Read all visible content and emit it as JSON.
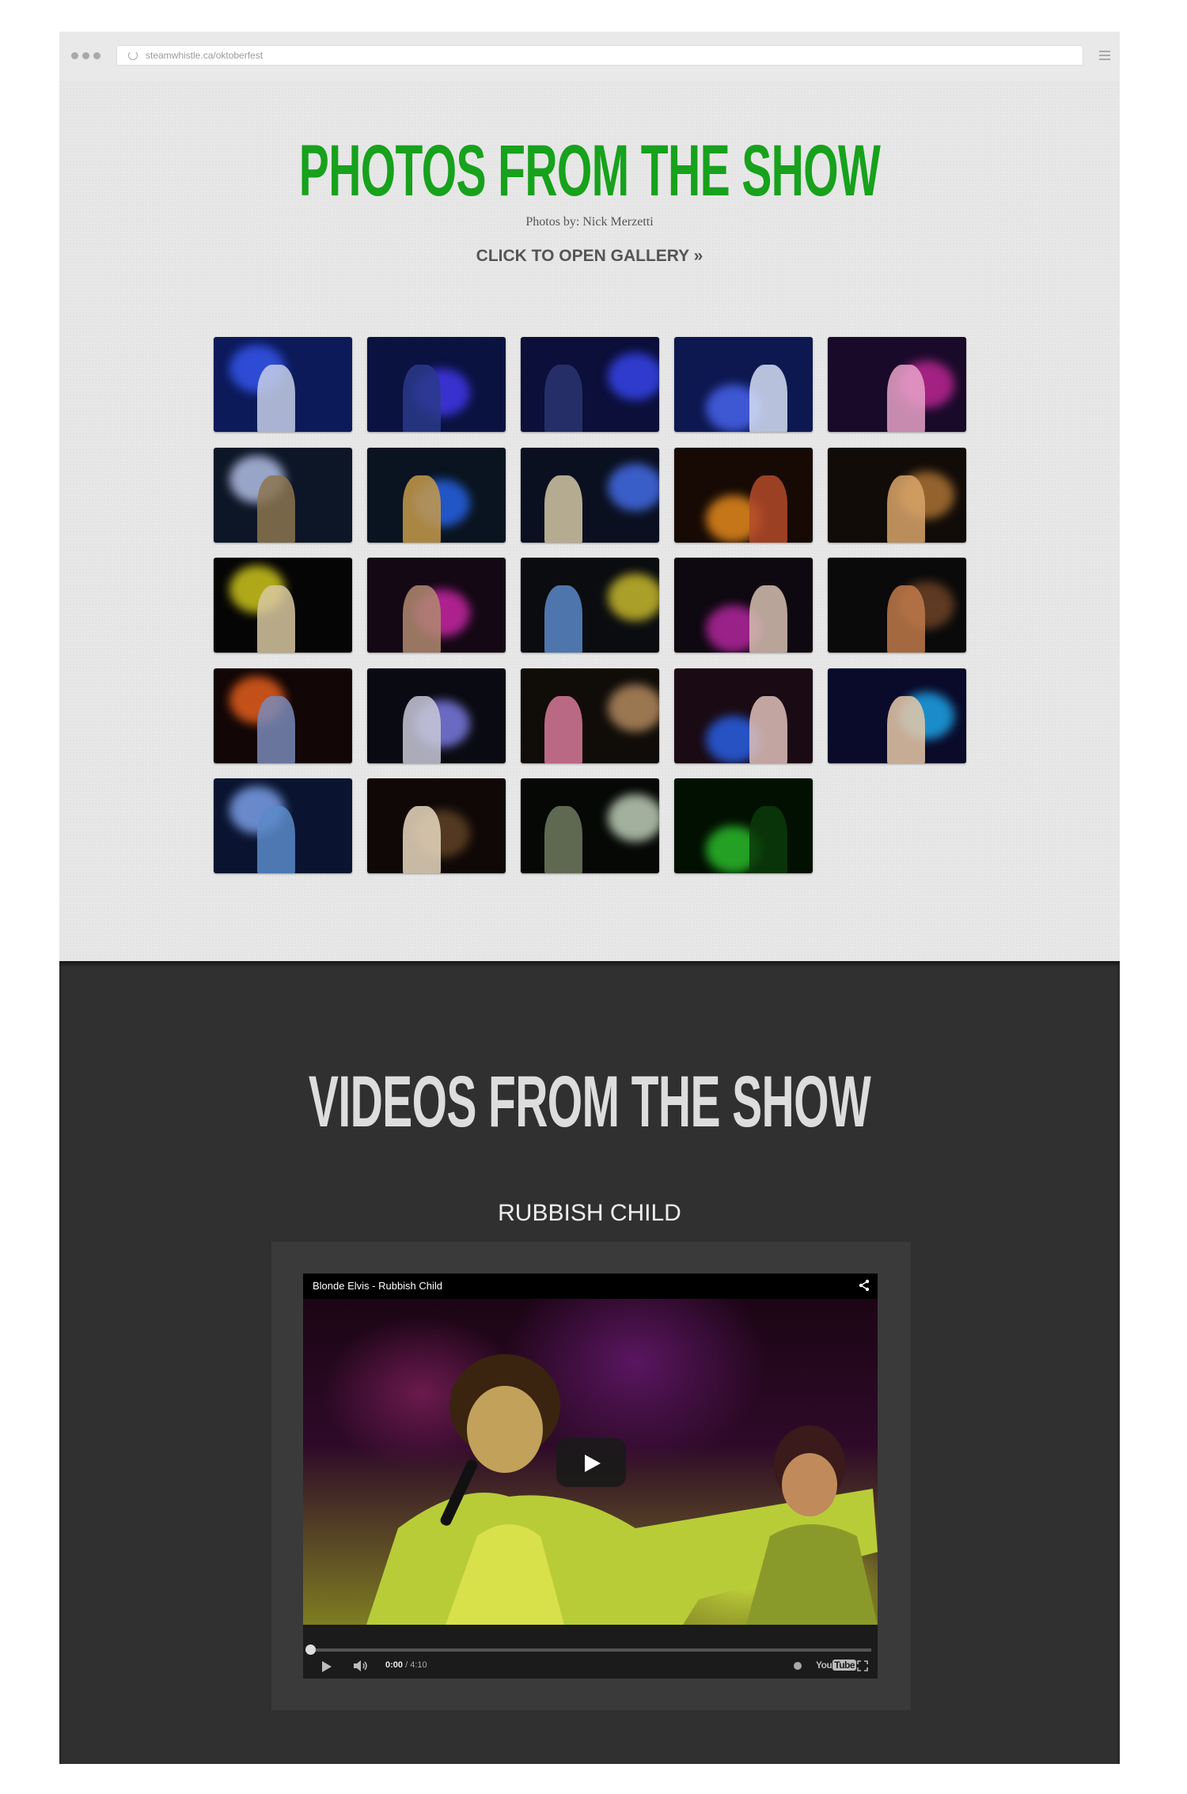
{
  "browser": {
    "url": "steamwhistle.ca/oktoberfest"
  },
  "photos_section": {
    "title": "PHOTOS FROM THE SHOW",
    "credit": "Photos by: Nick Merzetti",
    "gallery_link": "CLICK TO OPEN GALLERY »",
    "thumbnails": [
      {
        "bg": "#0c1a5a",
        "glow": "#3a5cff",
        "fig": "#c7cfe8"
      },
      {
        "bg": "#0a1240",
        "glow": "#4a3cff",
        "fig": "#2a3a8a"
      },
      {
        "bg": "#0b0f3a",
        "glow": "#3b4bff",
        "fig": "#2c3470"
      },
      {
        "bg": "#0d1850",
        "glow": "#4f6cff",
        "fig": "#d6dff5"
      },
      {
        "bg": "#1a0a2a",
        "glow": "#d02aa0",
        "fig": "#e8a2c8"
      },
      {
        "bg": "#0d1626",
        "glow": "#c9d6ff",
        "fig": "#8c7450"
      },
      {
        "bg": "#0a1420",
        "glow": "#2a6cff",
        "fig": "#c79a4a"
      },
      {
        "bg": "#0b1020",
        "glow": "#4a78ff",
        "fig": "#d4c7a6"
      },
      {
        "bg": "#170a05",
        "glow": "#ff9a20",
        "fig": "#b44a2a"
      },
      {
        "bg": "#120c08",
        "glow": "#c0803a",
        "fig": "#d8a46a"
      },
      {
        "bg": "#050505",
        "glow": "#e8e020",
        "fig": "#d8c8a0"
      },
      {
        "bg": "#140814",
        "glow": "#e02ab8",
        "fig": "#b08a70"
      },
      {
        "bg": "#0a0c10",
        "glow": "#e0d030",
        "fig": "#5a8ac8"
      },
      {
        "bg": "#0e0810",
        "glow": "#c82ab0",
        "fig": "#d6c0b0"
      },
      {
        "bg": "#0a0a0a",
        "glow": "#7a4a2a",
        "fig": "#c07a4a"
      },
      {
        "bg": "#120606",
        "glow": "#ff6a20",
        "fig": "#7a8ab8"
      },
      {
        "bg": "#0a0a12",
        "glow": "#8a8aff",
        "fig": "#c8c8d8"
      },
      {
        "bg": "#100c08",
        "glow": "#c89a6a",
        "fig": "#d87a9a"
      },
      {
        "bg": "#1a0a14",
        "glow": "#2a6aff",
        "fig": "#e0c0b8"
      },
      {
        "bg": "#0a0a2a",
        "glow": "#20b8ff",
        "fig": "#e8c8a8"
      },
      {
        "bg": "#0a1430",
        "glow": "#8ab0ff",
        "fig": "#5a8ac8"
      },
      {
        "bg": "#100806",
        "glow": "#6a4a2a",
        "fig": "#e8d8c0"
      },
      {
        "bg": "#050805",
        "glow": "#d8e8d0",
        "fig": "#707a60"
      },
      {
        "bg": "#021002",
        "glow": "#30d030",
        "fig": "#0a3a0a"
      }
    ]
  },
  "videos_section": {
    "title": "VIDEOS FROM THE SHOW",
    "video_name": "RUBBISH CHILD",
    "player": {
      "title": "Blonde Elvis - Rubbish Child",
      "time_current": "0:00",
      "time_total": "/ 4:10",
      "logo_you": "You",
      "logo_tube": "Tube",
      "progress": 0
    }
  }
}
